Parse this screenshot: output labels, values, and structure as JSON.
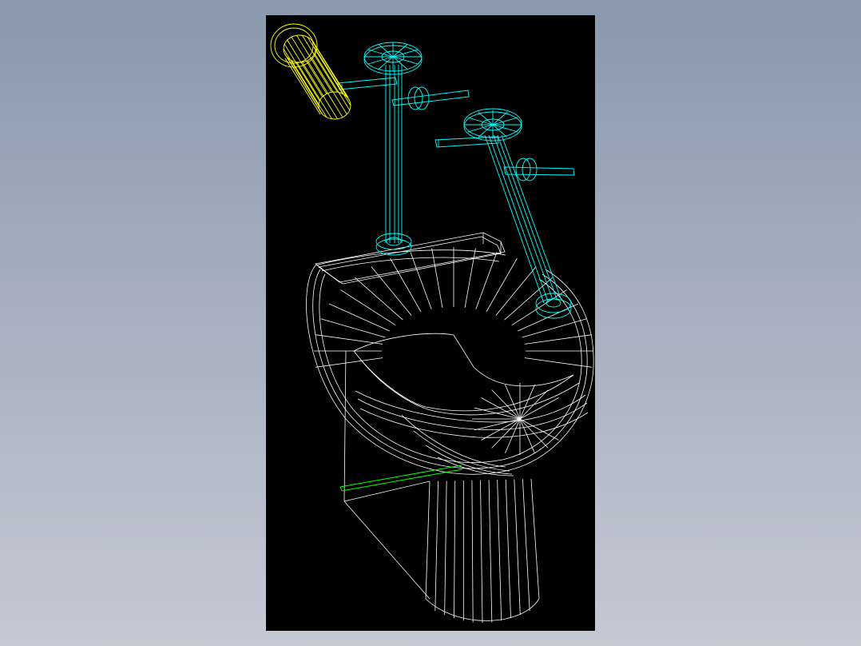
{
  "theme": {
    "background_top": "#8a98ad",
    "background_bottom": "#c4c9d4",
    "viewport_background": "#000000"
  },
  "model": {
    "render_style": "wireframe",
    "parts": [
      {
        "name": "toilet-bowl",
        "color": "#ffffff"
      },
      {
        "name": "supply-pipe-left",
        "color": "#00ffff"
      },
      {
        "name": "supply-pipe-right",
        "color": "#00ffff"
      },
      {
        "name": "drain-fitting",
        "color": "#ffff00"
      },
      {
        "name": "pedestal-edge",
        "color": "#00ff00"
      }
    ]
  }
}
